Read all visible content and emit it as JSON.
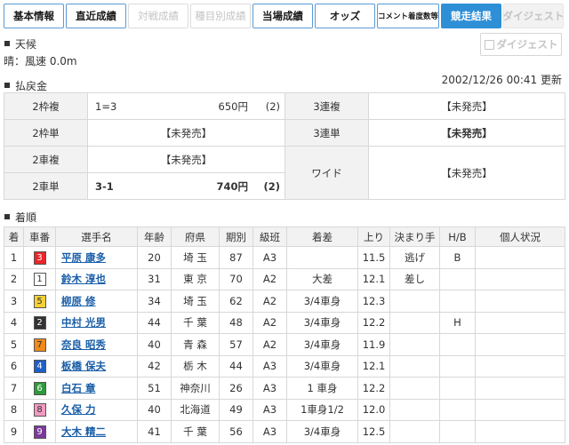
{
  "tabs": [
    {
      "label": "基本情報",
      "state": "normal"
    },
    {
      "label": "直近成績",
      "state": "normal"
    },
    {
      "label": "対戦成績",
      "state": "disabled"
    },
    {
      "label": "種目別成績",
      "state": "disabled"
    },
    {
      "label": "当場成績",
      "state": "normal"
    },
    {
      "label": "オッズ",
      "state": "normal"
    },
    {
      "label": "コメント着度数等",
      "state": "small"
    },
    {
      "label": "競走結果",
      "state": "active"
    },
    {
      "label": "ダイジェスト",
      "state": "grey"
    }
  ],
  "weather": {
    "heading": "天候",
    "text": "晴：風速 0.0m"
  },
  "digest_button": {
    "label": "ダイジェスト"
  },
  "payout": {
    "heading": "払戻金",
    "updated": "2002/12/26 00:41 更新",
    "rows": [
      {
        "l1": "2枠複",
        "combo": "1=3",
        "amount": "650円",
        "pop": "(2)",
        "l2": "3連複",
        "v2": "【未発売】"
      },
      {
        "l1": "2枠単",
        "v1": "【未発売】",
        "l2": "3連単",
        "v2": "【未発売】"
      },
      {
        "l1": "2車複",
        "v1": "【未発売】",
        "l2": "ワイド",
        "v2": "【未発売】"
      },
      {
        "l1": "2車単",
        "combo": "3-1",
        "amount": "740円",
        "pop": "(2)"
      }
    ]
  },
  "results": {
    "heading": "着順",
    "columns": [
      "着",
      "車番",
      "選手名",
      "年齢",
      "府県",
      "期別",
      "級班",
      "着差",
      "上り",
      "決まり手",
      "H/B",
      "個人状況"
    ],
    "rows": [
      {
        "rank": "1",
        "car": "3",
        "name": "平原 康多",
        "age": "20",
        "pref": "埼 玉",
        "term": "87",
        "class": "A3",
        "margin": "",
        "last": "11.5",
        "kimarite": "逃げ",
        "hb": "B",
        "status": ""
      },
      {
        "rank": "2",
        "car": "1",
        "name": "鈴木 淳也",
        "age": "31",
        "pref": "東 京",
        "term": "70",
        "class": "A2",
        "margin": "大差",
        "last": "12.1",
        "kimarite": "差し",
        "hb": "",
        "status": ""
      },
      {
        "rank": "3",
        "car": "5",
        "name": "柳原 修",
        "age": "34",
        "pref": "埼 玉",
        "term": "62",
        "class": "A2",
        "margin": "3/4車身",
        "last": "12.3",
        "kimarite": "",
        "hb": "",
        "status": ""
      },
      {
        "rank": "4",
        "car": "2",
        "name": "中村 光男",
        "age": "44",
        "pref": "千 葉",
        "term": "48",
        "class": "A2",
        "margin": "3/4車身",
        "last": "12.2",
        "kimarite": "",
        "hb": "H",
        "status": ""
      },
      {
        "rank": "5",
        "car": "7",
        "name": "奈良 昭秀",
        "age": "40",
        "pref": "青 森",
        "term": "57",
        "class": "A2",
        "margin": "3/4車身",
        "last": "11.9",
        "kimarite": "",
        "hb": "",
        "status": ""
      },
      {
        "rank": "6",
        "car": "4",
        "name": "板橋 保夫",
        "age": "42",
        "pref": "栃 木",
        "term": "44",
        "class": "A3",
        "margin": "3/4車身",
        "last": "12.1",
        "kimarite": "",
        "hb": "",
        "status": ""
      },
      {
        "rank": "7",
        "car": "6",
        "name": "白石 章",
        "age": "51",
        "pref": "神奈川",
        "term": "26",
        "class": "A3",
        "margin": "1 車身",
        "last": "12.2",
        "kimarite": "",
        "hb": "",
        "status": ""
      },
      {
        "rank": "8",
        "car": "8",
        "name": "久保 力",
        "age": "40",
        "pref": "北海道",
        "term": "49",
        "class": "A3",
        "margin": "1車身1/2",
        "last": "12.0",
        "kimarite": "",
        "hb": "",
        "status": ""
      },
      {
        "rank": "9",
        "car": "9",
        "name": "大木 精二",
        "age": "41",
        "pref": "千 葉",
        "term": "56",
        "class": "A3",
        "margin": "3/4車身",
        "last": "12.5",
        "kimarite": "",
        "hb": "",
        "status": ""
      }
    ]
  },
  "car_colors": {
    "1": {
      "bg": "#ffffff",
      "fg": "#333333"
    },
    "2": {
      "bg": "#333333",
      "fg": "#ffffff"
    },
    "3": {
      "bg": "#e8262b",
      "fg": "#ffffff"
    },
    "4": {
      "bg": "#1e5fc8",
      "fg": "#ffffff"
    },
    "5": {
      "bg": "#f5d033",
      "fg": "#333333"
    },
    "6": {
      "bg": "#2e9a3c",
      "fg": "#ffffff"
    },
    "7": {
      "bg": "#f08a1c",
      "fg": "#333333"
    },
    "8": {
      "bg": "#f29ac2",
      "fg": "#333333"
    },
    "9": {
      "bg": "#7a3a9a",
      "fg": "#ffffff"
    }
  }
}
